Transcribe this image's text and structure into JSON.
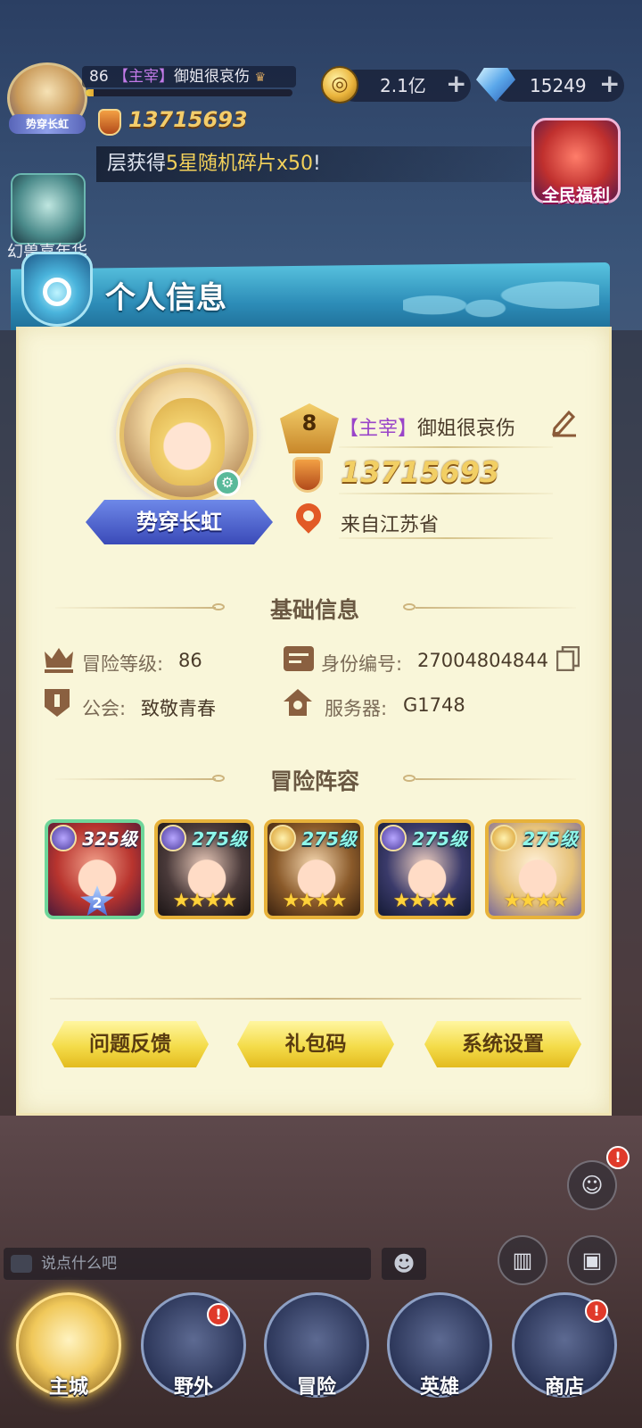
{
  "hud": {
    "level": "86",
    "role_tag": "【主宰】",
    "player_name": "御姐很哀伤",
    "avatar_title": "势穿长虹",
    "power": "13715693",
    "gold": "2.1亿",
    "diamonds": "15249",
    "exp_progress": 0.04
  },
  "notice": {
    "prefix": "层获得",
    "highlight": "5星随机碎片x50",
    "suffix": "!"
  },
  "side_icons": {
    "welfare_label": "全民福利",
    "beast_label": "幻兽嘉年华"
  },
  "panel": {
    "title": "个人信息",
    "player": {
      "level": "8",
      "role_tag": "【主宰】",
      "name": "御姐很哀伤",
      "power": "13715693",
      "location": "来自江苏省",
      "avatar_title": "势穿长虹"
    },
    "basic_info": {
      "title": "基础信息",
      "adventure_level_label": "冒险等级:",
      "adventure_level_value": "86",
      "id_label": "身份编号:",
      "id_value": "27004804844",
      "guild_label": "公会:",
      "guild_value": "致敬青春",
      "server_label": "服务器:",
      "server_value": "G1748"
    },
    "lineup": {
      "title": "冒险阵容",
      "heroes": [
        {
          "level": "325级",
          "faction": "purple",
          "stars": "",
          "advance": "2"
        },
        {
          "level": "275级",
          "faction": "purple",
          "stars": "★★★★",
          "advance": ""
        },
        {
          "level": "275级",
          "faction": "gold",
          "stars": "★★★★",
          "advance": ""
        },
        {
          "level": "275级",
          "faction": "purple",
          "stars": "★★★★",
          "advance": ""
        },
        {
          "level": "275级",
          "faction": "gold",
          "stars": "★★★★",
          "advance": ""
        }
      ]
    },
    "buttons": {
      "feedback": "问题反馈",
      "gift_code": "礼包码",
      "settings": "系统设置"
    }
  },
  "chat": {
    "placeholder": "说点什么吧"
  },
  "nav": {
    "items": [
      {
        "label": "主城"
      },
      {
        "label": "野外",
        "badge": "!"
      },
      {
        "label": "冒险"
      },
      {
        "label": "英雄"
      },
      {
        "label": "商店",
        "badge": "!"
      }
    ]
  },
  "colors": {
    "panel_bg": "#f9f6d9",
    "header_blue": "#2d8db8",
    "button_yellow": "#f4dc4a",
    "power_gold": "#f2cf64",
    "role_purple": "#9a45c9"
  }
}
